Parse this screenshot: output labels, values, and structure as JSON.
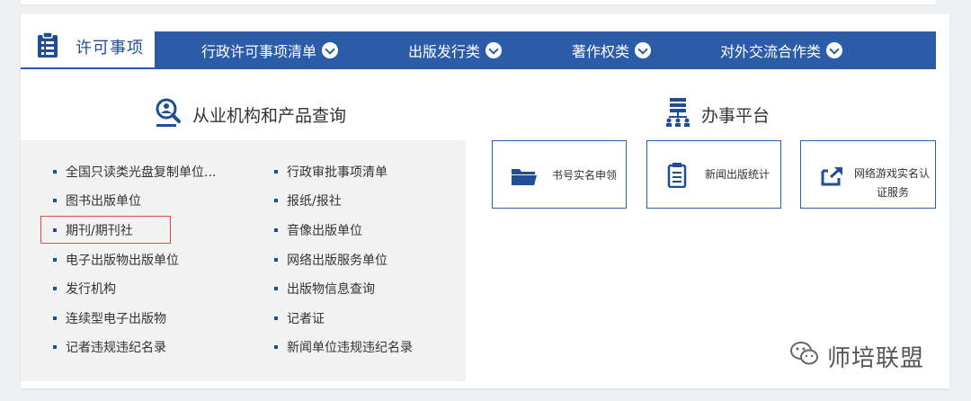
{
  "nav": {
    "active_tab": "许可事项",
    "items": [
      {
        "label": "行政许可事项清单"
      },
      {
        "label": "出版发行类"
      },
      {
        "label": "著作权类"
      },
      {
        "label": "对外交流合作类"
      }
    ]
  },
  "query": {
    "title": "从业机构和产品查询",
    "left_links": [
      "全国只读类光盘复制单位...",
      "图书出版单位",
      "期刊/期刊社",
      "电子出版物出版单位",
      "发行机构",
      "连续型电子出版物",
      "记者违规违纪名录"
    ],
    "right_links": [
      "行政审批事项清单",
      "报纸/报社",
      "音像出版单位",
      "网络出版服务单位",
      "出版物信息查询",
      "记者证",
      "新闻单位违规违纪名录"
    ]
  },
  "platform": {
    "title": "办事平台",
    "tiles": [
      {
        "label": "书号实名申领",
        "icon": "folder-icon"
      },
      {
        "label": "新闻出版统计",
        "icon": "document-list-icon"
      },
      {
        "label_line1": "网络游戏实名认",
        "label_line2": "证服务",
        "icon": "external-link-icon"
      }
    ]
  },
  "watermark": {
    "text": "师培联盟"
  },
  "colors": {
    "brand_blue": "#2c5ba8",
    "highlight_red": "#e24a4a"
  }
}
